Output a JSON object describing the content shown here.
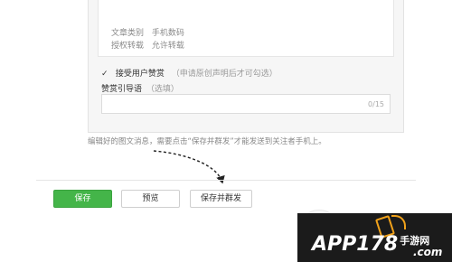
{
  "article_meta": {
    "category_label": "文章类别",
    "category_value": "手机数码",
    "repost_label": "授权转载",
    "repost_value": "允许转载"
  },
  "reward": {
    "checked": true,
    "label": "接受用户赞赏",
    "hint": "（申请原创声明后才可勾选）"
  },
  "guide": {
    "label": "赞赏引导语",
    "optional": "（选填）",
    "counter": "0/15"
  },
  "notice": "编辑好的图文消息，需要点击“保存并群发”才能发送到关注者手机上。",
  "buttons": {
    "save": "保存",
    "preview": "预览",
    "save_and_send": "保存并群发"
  },
  "watermark": {
    "text": "APP178",
    "sub": "手游网",
    "dotcom": ".com"
  },
  "colors": {
    "primary_button": "#44b549",
    "watermark_bg": "#1b1b1b",
    "watermark_accent": "#f0a11a"
  }
}
